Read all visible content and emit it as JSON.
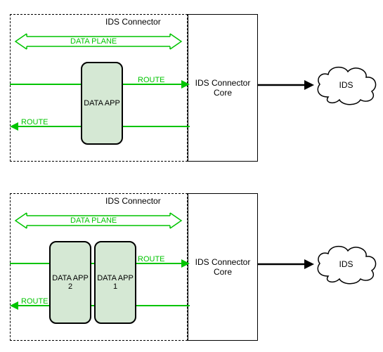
{
  "diagram1": {
    "connector_label": "IDS Connector",
    "data_plane": "DATA PLANE",
    "route_in": "ROUTE",
    "route_out": "ROUTE",
    "data_app": "DATA APP",
    "core": "IDS Connector\nCore",
    "cloud": "IDS"
  },
  "diagram2": {
    "connector_label": "IDS Connector",
    "data_plane": "DATA PLANE",
    "route_in": "ROUTE",
    "route_out": "ROUTE",
    "data_app_1": "DATA APP\n1",
    "data_app_2": "DATA APP\n2",
    "core": "IDS Connector\nCore",
    "cloud": "IDS"
  }
}
